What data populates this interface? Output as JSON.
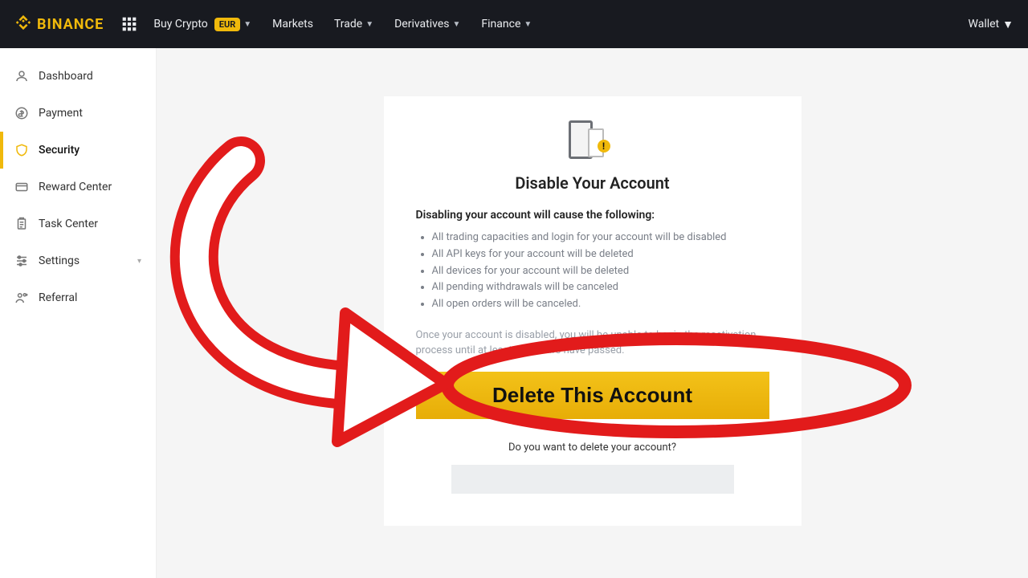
{
  "topbar": {
    "brand": "BINANCE",
    "buy_crypto": "Buy Crypto",
    "currency": "EUR",
    "markets": "Markets",
    "trade": "Trade",
    "derivatives": "Derivatives",
    "finance": "Finance",
    "wallet": "Wallet"
  },
  "sidebar": {
    "items": [
      {
        "label": "Dashboard"
      },
      {
        "label": "Payment"
      },
      {
        "label": "Security"
      },
      {
        "label": "Reward Center"
      },
      {
        "label": "Task Center"
      },
      {
        "label": "Settings"
      },
      {
        "label": "Referral"
      }
    ]
  },
  "card": {
    "title": "Disable Your Account",
    "lead": "Disabling your account will cause the following:",
    "bullets": [
      "All trading capacities and login for your account will be disabled",
      "All API keys for your account will be deleted",
      "All devices for your account will be deleted",
      "All pending withdrawals will be canceled",
      "All open orders will be canceled."
    ],
    "note": "Once your account is disabled, you will be unable to begin the reactivation process until at least two hours have passed.",
    "cta": "Delete This Account",
    "sub_question": "Do you want to delete your account?"
  },
  "colors": {
    "accent": "#f0b90b",
    "overlay_red": "#e21b1b"
  }
}
